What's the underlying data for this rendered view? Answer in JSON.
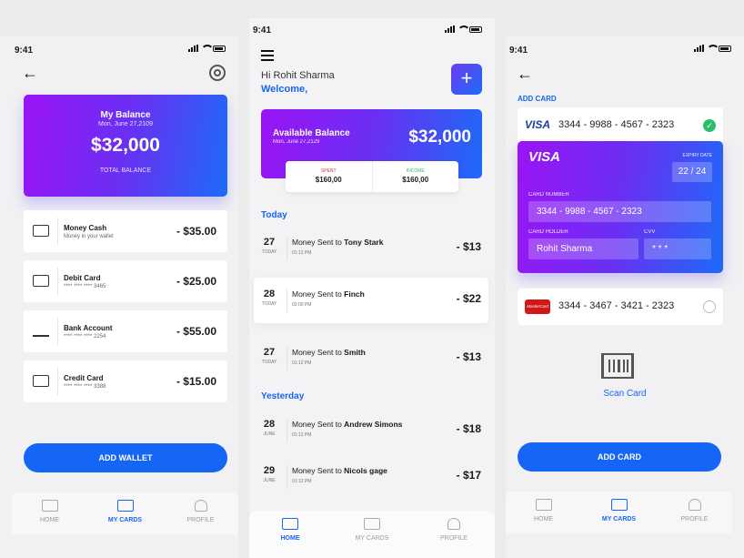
{
  "status": {
    "time": "9:41"
  },
  "screen1": {
    "balance_title": "My Balance",
    "balance_date": "Mon, June 27,2109",
    "balance_amount": "$32,000",
    "balance_caption": "TOTAL BALANCE",
    "wallets": [
      {
        "icon": "wallet-icon",
        "name": "Money Cash",
        "sub": "Money in your wallet",
        "amount": "- $35.00"
      },
      {
        "icon": "credit-card-icon",
        "name": "Debit Card",
        "sub": "**** **** **** 3465",
        "amount": "- $25.00"
      },
      {
        "icon": "bank-icon",
        "name": "Bank Account",
        "sub": "**** **** **** 2254",
        "amount": "- $55.00"
      },
      {
        "icon": "credit-card-icon",
        "name": "Credit Card",
        "sub": "**** **** **** 3388",
        "amount": "- $15.00"
      }
    ],
    "add_wallet": "ADD WALLET",
    "tabs": [
      {
        "label": "HOME"
      },
      {
        "label": "MY CARDS"
      },
      {
        "label": "PROFILE"
      }
    ],
    "active_tab": "MY CARDS"
  },
  "screen2": {
    "greeting": "Hi Rohit Sharma",
    "welcome": "Welcome,",
    "plus": "+",
    "balance_title": "Available Balance",
    "balance_date": "Mon, June 27,2129",
    "balance_amount": "$32,000",
    "spent_label": "SPENT",
    "spent_value": "$160,00",
    "income_label": "INCOME",
    "income_value": "$160,00",
    "today_label": "Today",
    "yesterday_label": "Yesterday",
    "transactions": [
      {
        "day": "27",
        "month": "TODAY",
        "prefix": "Money Sent to ",
        "name": "Tony Stark",
        "time": "01:12 PM",
        "amount": "- $13"
      },
      {
        "day": "28",
        "month": "TODAY",
        "prefix": "Money Sent to ",
        "name": "Finch",
        "time": "02:00 PM",
        "amount": "- $22"
      },
      {
        "day": "27",
        "month": "TODAY",
        "prefix": "Money Sent to ",
        "name": "Smith",
        "time": "01:12 PM",
        "amount": "- $13"
      },
      {
        "day": "28",
        "month": "JUNE",
        "prefix": "Money Sent to ",
        "name": "Andrew Simons",
        "time": "01:12 PM",
        "amount": "- $18"
      },
      {
        "day": "29",
        "month": "JUNE",
        "prefix": "Money Sent to ",
        "name": "Nicols gage",
        "time": "01:12 PM",
        "amount": "- $17"
      }
    ],
    "tabs": [
      {
        "label": "HOME"
      },
      {
        "label": "MY CARDS"
      },
      {
        "label": "PROFILE"
      }
    ],
    "active_tab": "HOME"
  },
  "screen3": {
    "header": "ADD CARD",
    "card1_brand": "VISA",
    "card1_number": "3344 - 9988 - 4567 - 2323",
    "big_brand": "VISA",
    "expiry_label": "EXPIRY DATE",
    "expiry_value": "22 / 24",
    "number_label": "CARD NUMBER",
    "number_value": "3344 - 9988 - 4567 - 2323",
    "holder_label": "CARD HOLDER",
    "holder_value": "Rohit Sharma",
    "cvv_label": "CVV",
    "cvv_value": "* * *",
    "card2_brand": "MasterCard",
    "card2_number": "3344 - 3467 - 3421 - 2323",
    "scan_label": "Scan Card",
    "add_card": "ADD CARD",
    "tabs": [
      {
        "label": "HOME"
      },
      {
        "label": "MY CARDS"
      },
      {
        "label": "PROFILE"
      }
    ],
    "active_tab": "MY CARDS"
  },
  "colors": {
    "accent": "#1565f6",
    "gradient_start": "#9b14f5",
    "gradient_end": "#1c6bf8",
    "success": "#2bbf6b",
    "mastercard": "#d01818"
  }
}
